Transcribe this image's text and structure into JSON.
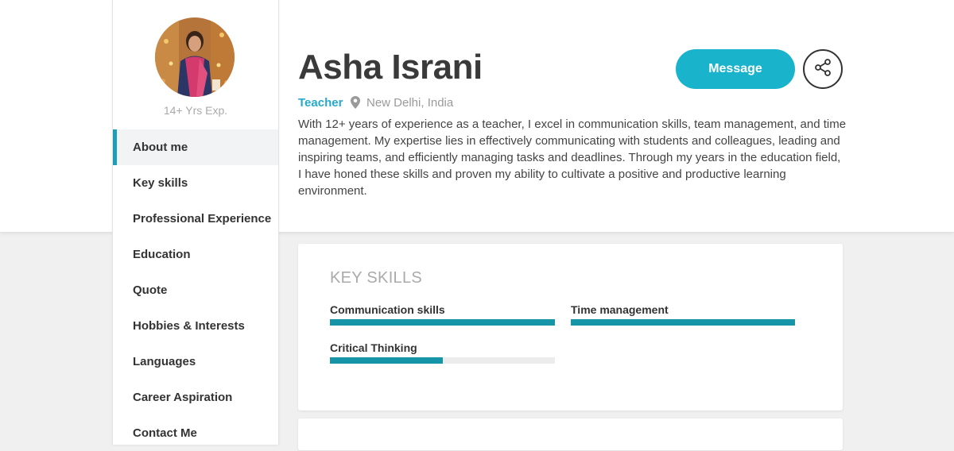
{
  "profile": {
    "name": "Asha Israni",
    "experience": "14+ Yrs Exp.",
    "role": "Teacher",
    "location": "New Delhi, India",
    "about": "With 12+ years of experience as a teacher, I excel in communication skills, team management, and time management. My expertise lies in effectively communicating with students and colleagues, leading and inspiring teams, and efficiently managing tasks and deadlines. Through my years in the education field, I have honed these skills and proven my ability to cultivate a positive and productive learning environment."
  },
  "actions": {
    "message_label": "Message",
    "share_icon": "share-icon"
  },
  "sidebar": {
    "items": [
      {
        "label": "About me",
        "active": true
      },
      {
        "label": "Key skills",
        "active": false
      },
      {
        "label": "Professional Experience",
        "active": false
      },
      {
        "label": "Education",
        "active": false
      },
      {
        "label": "Quote",
        "active": false
      },
      {
        "label": "Hobbies & Interests",
        "active": false
      },
      {
        "label": "Languages",
        "active": false
      },
      {
        "label": "Career Aspiration",
        "active": false
      },
      {
        "label": "Contact Me",
        "active": false
      }
    ]
  },
  "key_skills": {
    "title": "KEY SKILLS",
    "skills": [
      {
        "name": "Communication skills",
        "level": 1.0
      },
      {
        "name": "Time management",
        "level": 1.0
      },
      {
        "name": "Critical Thinking",
        "level": 0.5
      }
    ]
  },
  "colors": {
    "accent": "#1ab3cc",
    "bar": "#1795a8",
    "role": "#27a9c9"
  }
}
